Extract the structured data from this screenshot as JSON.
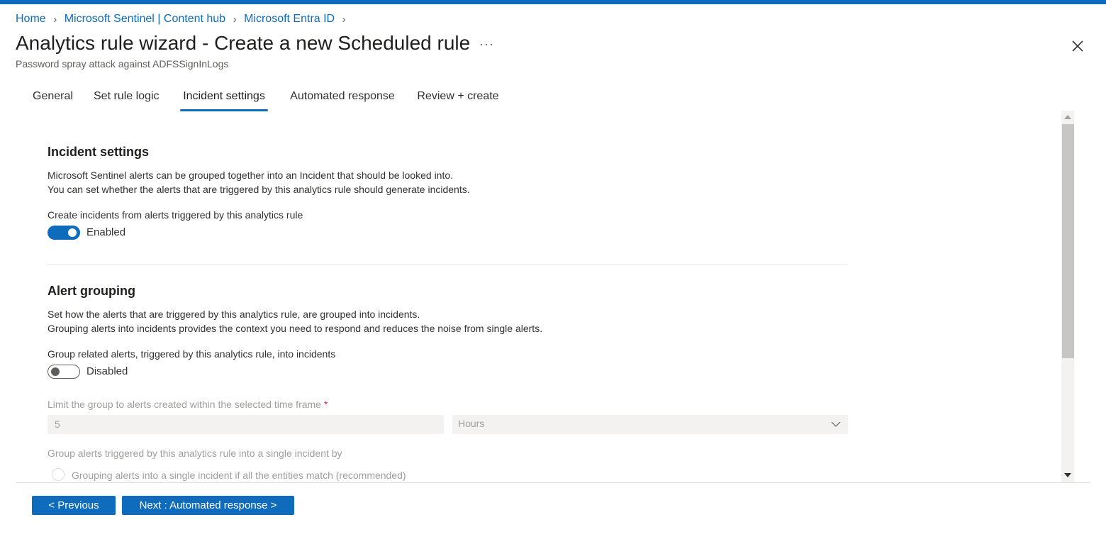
{
  "colors": {
    "accent": "#0f6cbd",
    "required": "#c4314b",
    "disabled_text": "#a19f9d"
  },
  "breadcrumb": [
    {
      "label": "Home"
    },
    {
      "label": "Microsoft Sentinel | Content hub"
    },
    {
      "label": "Microsoft Entra ID"
    }
  ],
  "header": {
    "title": "Analytics rule wizard - Create a new Scheduled rule",
    "more_label": "···",
    "subtitle": "Password spray attack against ADFSSignInLogs",
    "close_icon": "close-icon"
  },
  "tabs": [
    {
      "label": "General"
    },
    {
      "label": "Set rule logic"
    },
    {
      "label": "Incident settings",
      "active": true
    },
    {
      "label": "Automated response"
    },
    {
      "label": "Review + create"
    }
  ],
  "incident_settings": {
    "title": "Incident settings",
    "description_line1": "Microsoft Sentinel alerts can be grouped together into an Incident that should be looked into.",
    "description_line2": "You can set whether the alerts that are triggered by this analytics rule should generate incidents.",
    "create_incidents_label": "Create incidents from alerts triggered by this analytics rule",
    "toggle_state": "Enabled"
  },
  "alert_grouping": {
    "title": "Alert grouping",
    "description_line1": "Set how the alerts that are triggered by this analytics rule, are grouped into incidents.",
    "description_line2": "Grouping alerts into incidents provides the context you need to respond and reduces the noise from single alerts.",
    "group_related_label": "Group related alerts, triggered by this analytics rule, into incidents",
    "toggle_state": "Disabled",
    "time_frame_label": "Limit the group to alerts created within the selected time frame",
    "required_mark": "*",
    "time_frame_value": "5",
    "time_unit_value": "Hours",
    "group_by_label": "Group alerts triggered by this analytics rule into a single incident by",
    "option_1": "Grouping alerts into a single incident if all the entities match (recommended)"
  },
  "footer": {
    "previous_label": "< Previous",
    "next_label": "Next : Automated response >"
  }
}
